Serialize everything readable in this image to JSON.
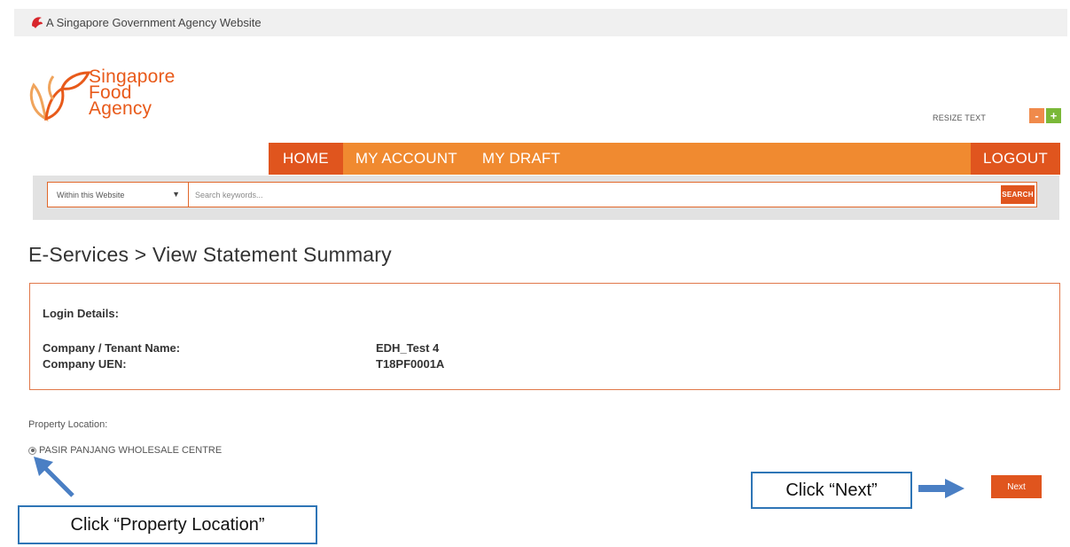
{
  "gov_banner": {
    "text": "A Singapore Government Agency Website"
  },
  "brand": {
    "line1": "Singapore",
    "line2": "Food",
    "line3": "Agency"
  },
  "resize": {
    "label": "RESIZE TEXT",
    "minus": "-",
    "plus": "+"
  },
  "nav": {
    "items": [
      "HOME",
      "MY ACCOUNT",
      "MY DRAFT"
    ],
    "logout": "LOGOUT"
  },
  "search": {
    "scope": "Within this Website",
    "placeholder": "Search keywords...",
    "button": "SEARCH"
  },
  "page": {
    "title": "E-Services > View Statement Summary"
  },
  "login_details": {
    "title": "Login Details:",
    "company_label": "Company / Tenant Name:",
    "company_value": "EDH_Test 4",
    "uen_label": "Company UEN:",
    "uen_value": "T18PF0001A"
  },
  "property": {
    "label": "Property Location:",
    "option": "PASIR PANJANG WHOLESALE CENTRE",
    "selected": true
  },
  "next_button": "Next",
  "callouts": {
    "next": "Click “Next”",
    "property": "Click “Property Location”"
  },
  "colors": {
    "brand_orange": "#e0551e",
    "nav_orange": "#f08a30",
    "callout_blue": "#2e75b6",
    "plus_green": "#7ab838"
  }
}
